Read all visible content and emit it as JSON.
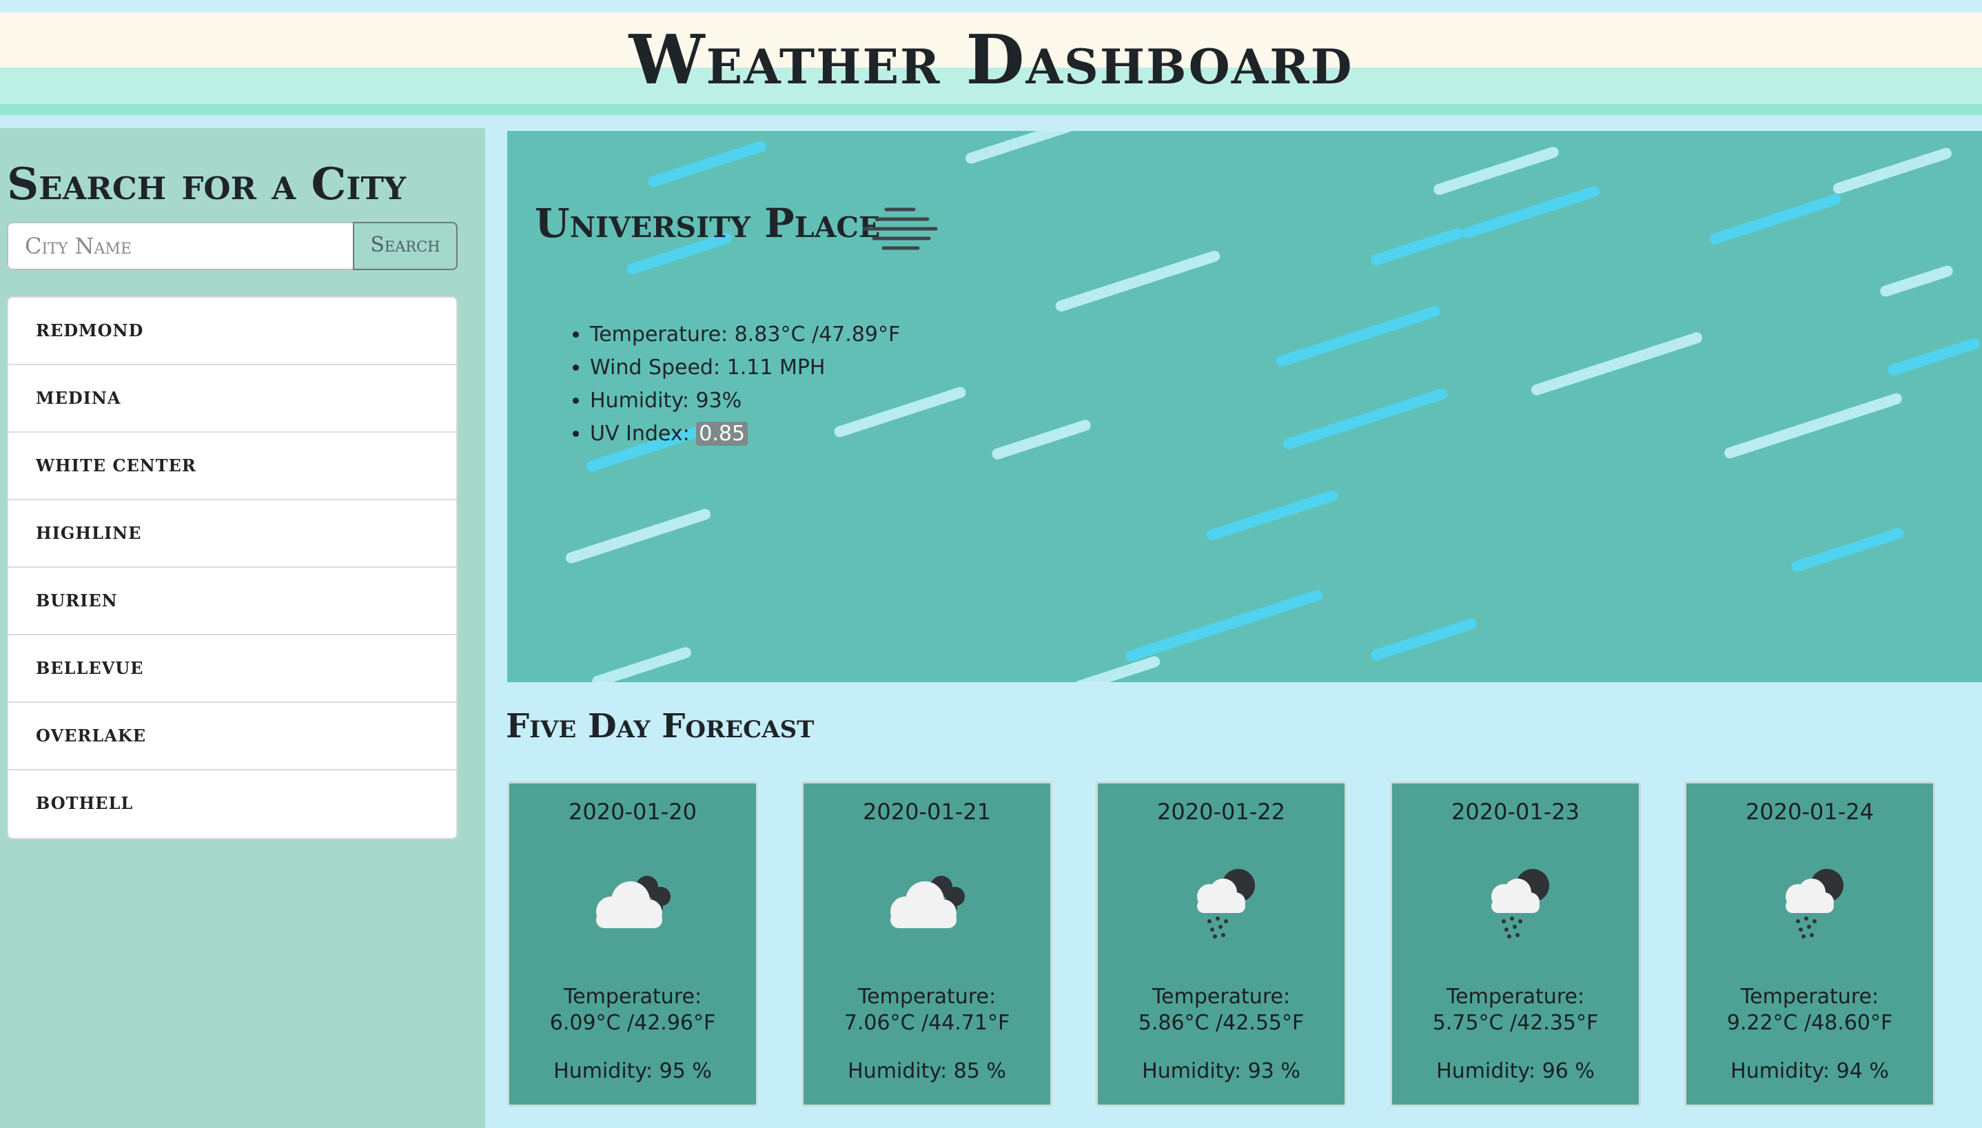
{
  "header": {
    "title": "Weather Dashboard"
  },
  "sidebar": {
    "heading": "Search for a City",
    "search_placeholder": "City Name",
    "search_button": "Search",
    "cities": [
      "REDMOND",
      "MEDINA",
      "WHITE CENTER",
      "HIGHLINE",
      "BURIEN",
      "BELLEVUE",
      "OVERLAKE",
      "BOTHELL"
    ]
  },
  "current": {
    "city": "University Place",
    "icon": "mist-icon",
    "temperature_label": "Temperature: 8.83°C /47.89°F",
    "wind_label": "Wind Speed: 1.11 MPH",
    "humidity_label": "Humidity: 93%",
    "uv_label": "UV Index: ",
    "uv_value": "0.85",
    "uv_badge_color": "#7e8a88"
  },
  "forecast": {
    "heading": "Five Day Forecast",
    "days": [
      {
        "date": "2020-01-20",
        "icon": "cloudy-night-icon",
        "temp_label": "Temperature:",
        "temp": "6.09°C /42.96°F",
        "humidity": "Humidity: 95 %"
      },
      {
        "date": "2020-01-21",
        "icon": "cloudy-night-icon",
        "temp_label": "Temperature:",
        "temp": "7.06°C /44.71°F",
        "humidity": "Humidity: 85 %"
      },
      {
        "date": "2020-01-22",
        "icon": "rain-night-icon",
        "temp_label": "Temperature:",
        "temp": "5.86°C /42.55°F",
        "humidity": "Humidity: 93 %"
      },
      {
        "date": "2020-01-23",
        "icon": "rain-night-icon",
        "temp_label": "Temperature:",
        "temp": "5.75°C /42.35°F",
        "humidity": "Humidity: 96 %"
      },
      {
        "date": "2020-01-24",
        "icon": "rain-night-icon",
        "temp_label": "Temperature:",
        "temp": "9.22°C /48.60°F",
        "humidity": "Humidity: 94 %"
      }
    ]
  },
  "colors": {
    "header_cream": "#fcf9ec",
    "header_mint": "#bdf0e4",
    "sidebar": "#a6d9cc",
    "panel": "#62bfb6",
    "card": "#4ea295",
    "page_bg": "#c6eef9"
  }
}
